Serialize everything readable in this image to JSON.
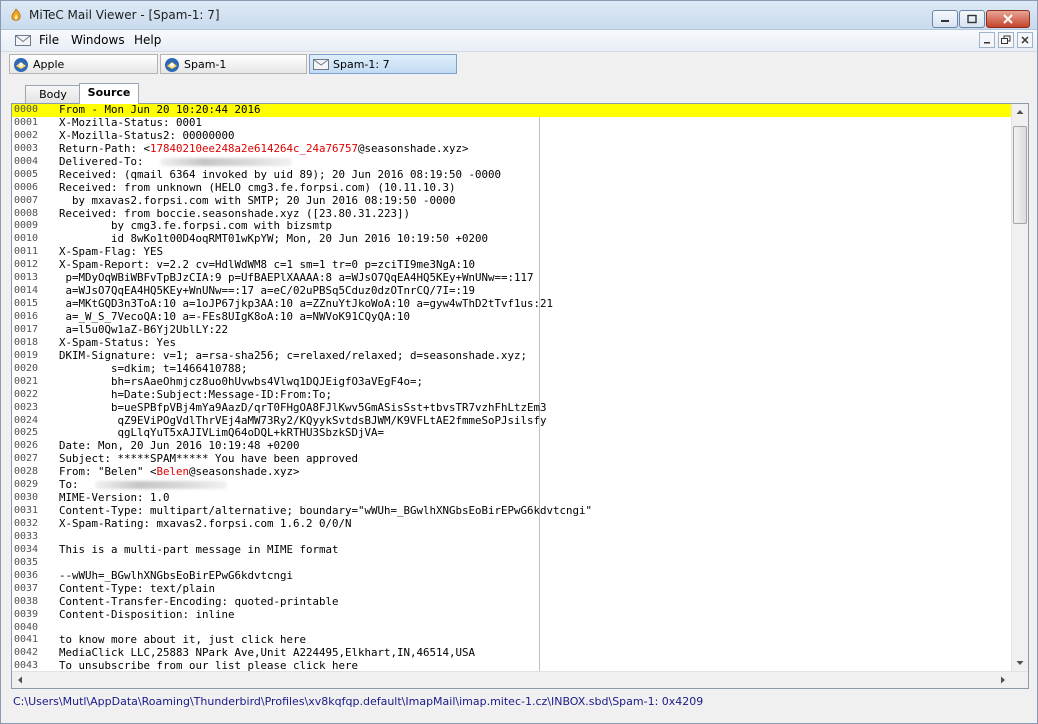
{
  "window": {
    "title": "MiTeC Mail Viewer - [Spam-1: 7]"
  },
  "menu": {
    "items": [
      "File",
      "Windows",
      "Help"
    ]
  },
  "window_tabs": [
    {
      "label": "Apple",
      "icon": "thunderbird-icon"
    },
    {
      "label": "Spam-1",
      "icon": "thunderbird-icon"
    },
    {
      "label": "Spam-1: 7",
      "icon": "envelope-icon",
      "active": true
    }
  ],
  "view_tabs": [
    {
      "label": "Body"
    },
    {
      "label": "Source",
      "active": true
    }
  ],
  "source_lines": [
    {
      "n": "0000",
      "t": "From - Mon Jun 20 10:20:44 2016",
      "hl": true
    },
    {
      "n": "0001",
      "t": "X-Mozilla-Status: 0001"
    },
    {
      "n": "0002",
      "t": "X-Mozilla-Status2: 00000000"
    },
    {
      "n": "0003",
      "t": "Return-Path: <",
      "red": "17840210ee248a2e614264c_24a76757",
      "post": "@seasonshade.xyz>"
    },
    {
      "n": "0004",
      "t": "Delivered-To: ",
      "blur": true
    },
    {
      "n": "0005",
      "t": "Received: (qmail 6364 invoked by uid 89); 20 Jun 2016 08:19:50 -0000"
    },
    {
      "n": "0006",
      "t": "Received: from unknown (HELO cmg3.fe.forpsi.com) (10.11.10.3)"
    },
    {
      "n": "0007",
      "t": "  by mxavas2.forpsi.com with SMTP; 20 Jun 2016 08:19:50 -0000"
    },
    {
      "n": "0008",
      "t": "Received: from boccie.seasonshade.xyz ([23.80.31.223])"
    },
    {
      "n": "0009",
      "t": "        by cmg3.fe.forpsi.com with bizsmtp"
    },
    {
      "n": "0010",
      "t": "        id 8wKo1t00D4oqRMT01wKpYW; Mon, 20 Jun 2016 10:19:50 +0200"
    },
    {
      "n": "0011",
      "t": "X-Spam-Flag: YES"
    },
    {
      "n": "0012",
      "t": "X-Spam-Report: v=2.2 cv=HdlWdWM8 c=1 sm=1 tr=0 p=zciTI9me3NgA:10"
    },
    {
      "n": "0013",
      "t": " p=MDyOqWBiWBFvTpBJzCIA:9 p=UfBAEPlXAAAA:8 a=WJsO7QqEA4HQ5KEy+WnUNw==:117"
    },
    {
      "n": "0014",
      "t": " a=WJsO7QqEA4HQ5KEy+WnUNw==:17 a=eC/02uPBSq5Cduz0dzOTnrCQ/7I=:19"
    },
    {
      "n": "0015",
      "t": " a=MKtGQD3n3ToA:10 a=1oJP67jkp3AA:10 a=ZZnuYtJkoWoA:10 a=gyw4wThD2tTvf1us:21"
    },
    {
      "n": "0016",
      "t": " a=_W_S_7VecoQA:10 a=-FEs8UIgK8oA:10 a=NWVoK91CQyQA:10"
    },
    {
      "n": "0017",
      "t": " a=l5u0Qw1aZ-B6Yj2UblLY:22"
    },
    {
      "n": "0018",
      "t": "X-Spam-Status: Yes"
    },
    {
      "n": "0019",
      "t": "DKIM-Signature: v=1; a=rsa-sha256; c=relaxed/relaxed; d=seasonshade.xyz;"
    },
    {
      "n": "0020",
      "t": "        s=dkim; t=1466410788;"
    },
    {
      "n": "0021",
      "t": "        bh=rsAaeOhmjcz8uo0hUvwbs4Vlwq1DQJEigfO3aVEgF4o=;"
    },
    {
      "n": "0022",
      "t": "        h=Date:Subject:Message-ID:From:To;"
    },
    {
      "n": "0023",
      "t": "        b=ueSPBfpVBj4mYa9AazD/qrT0FHgOA8FJlKwv5GmASisSst+tbvsTR7vzhFhLtzEm3"
    },
    {
      "n": "0024",
      "t": "         qZ9EViPOgVdlThrVEj4aMW73Ry2/KQyykSvtdsBJWM/K9VFLtAE2fmmeSoPJsilsfy"
    },
    {
      "n": "0025",
      "t": "         qgLlqYuT5xAJIVLimQ64oDQL+kRTHU3SbzkSDjVA="
    },
    {
      "n": "0026",
      "t": "Date: Mon, 20 Jun 2016 10:19:48 +0200"
    },
    {
      "n": "0027",
      "t": "Subject: *****SPAM***** You have been approved"
    },
    {
      "n": "0028",
      "t": "From: \"Belen\" <",
      "red": "Belen",
      "post": "@seasonshade.xyz>"
    },
    {
      "n": "0029",
      "t": "To: ",
      "blur": true
    },
    {
      "n": "0030",
      "t": "MIME-Version: 1.0"
    },
    {
      "n": "0031",
      "t": "Content-Type: multipart/alternative; boundary=\"wWUh=_BGwlhXNGbsEoBirEPwG6kdvtcngi\""
    },
    {
      "n": "0032",
      "t": "X-Spam-Rating: mxavas2.forpsi.com 1.6.2 0/0/N"
    },
    {
      "n": "0033",
      "t": ""
    },
    {
      "n": "0034",
      "t": "This is a multi-part message in MIME format"
    },
    {
      "n": "0035",
      "t": ""
    },
    {
      "n": "0036",
      "t": "--wWUh=_BGwlhXNGbsEoBirEPwG6kdvtcngi"
    },
    {
      "n": "0037",
      "t": "Content-Type: text/plain"
    },
    {
      "n": "0038",
      "t": "Content-Transfer-Encoding: quoted-printable"
    },
    {
      "n": "0039",
      "t": "Content-Disposition: inline"
    },
    {
      "n": "0040",
      "t": ""
    },
    {
      "n": "0041",
      "t": "to know more about it, just click here"
    },
    {
      "n": "0042",
      "t": "MediaClick LLC,25883 NPark Ave,Unit A224495,Elkhart,IN,46514,USA"
    },
    {
      "n": "0043",
      "t": "To unsubscribe from our list please click here"
    }
  ],
  "status": {
    "path": "C:\\Users\\Mutl\\AppData\\Roaming\\Thunderbird\\Profiles\\xv8kqfqp.default\\ImapMail\\imap.mitec-1.cz\\INBOX.sbd\\Spam-1: 0x4209"
  },
  "colors": {
    "highlight": "#ffff00",
    "address_red": "#e00000",
    "status_text": "#1a1a8a"
  }
}
